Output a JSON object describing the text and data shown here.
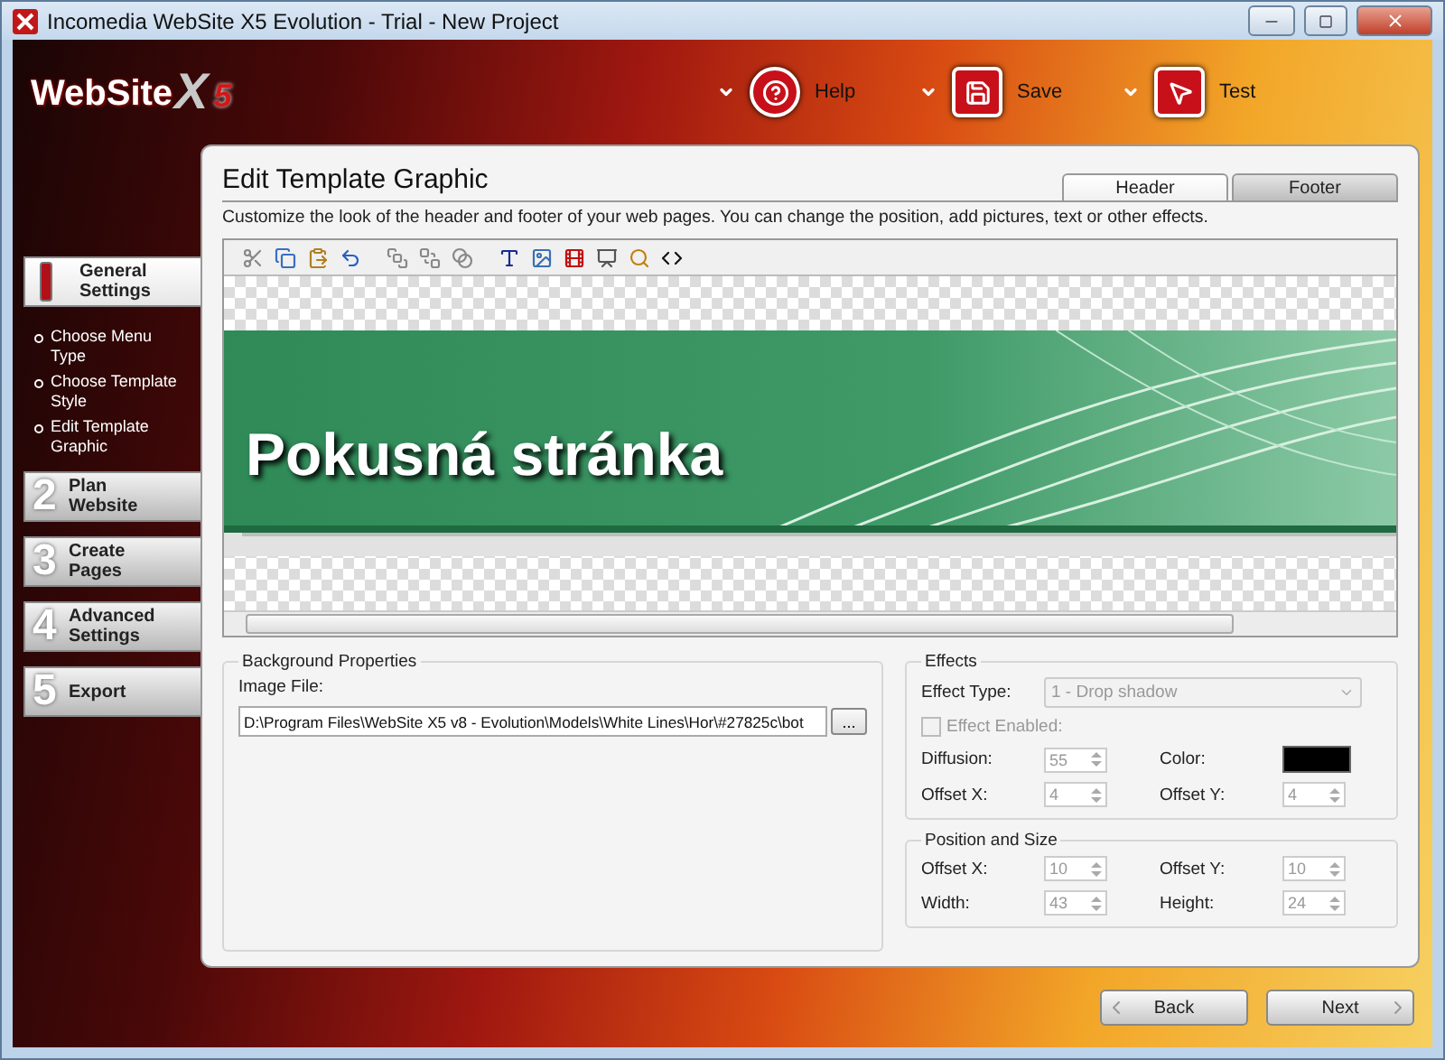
{
  "window": {
    "title": "Incomedia WebSite X5 Evolution - Trial - New Project"
  },
  "logo": {
    "name": "WebSite",
    "mark": "X",
    "version": "5"
  },
  "toolbar": [
    {
      "kind": "help",
      "label": "Help"
    },
    {
      "kind": "save",
      "label": "Save"
    },
    {
      "kind": "test",
      "label": "Test"
    }
  ],
  "steps": [
    {
      "label": "General Settings",
      "selected": true,
      "children": [
        {
          "label": "Choose Menu Type"
        },
        {
          "label": "Choose Template Style"
        },
        {
          "label": "Edit Template Graphic"
        }
      ]
    },
    {
      "number": "2",
      "label": "Plan Website",
      "selected": false
    },
    {
      "number": "3",
      "label": "Create Pages",
      "selected": false
    },
    {
      "number": "4",
      "label": "Advanced Settings",
      "selected": false
    },
    {
      "number": "5",
      "label": "Export",
      "selected": false
    }
  ],
  "page": {
    "title": "Edit Template Graphic",
    "description": "Customize the look of the header and footer of your web pages. You can change the position, add pictures, text or other effects.",
    "tabs": [
      {
        "label": "Header",
        "selected": true
      },
      {
        "label": "Footer",
        "selected": false
      }
    ]
  },
  "preview": {
    "heading": "Pokusná stránka"
  },
  "background": {
    "legend": "Background Properties",
    "image_file": {
      "label": "Image File:",
      "value": "D:\\Program Files\\WebSite X5 v8 - Evolution\\Models\\White Lines\\Hor\\#27825c\\bot",
      "browse": "..."
    }
  },
  "effects": {
    "legend": "Effects",
    "effect_type": {
      "label": "Effect Type:",
      "value": "1 - Drop shadow",
      "disabled": true
    },
    "effect_enabled": {
      "label": "Effect Enabled:",
      "checked": false,
      "disabled": true
    },
    "fields": [
      {
        "kind": "spin",
        "label": "Diffusion:",
        "value": "55",
        "disabled": true
      },
      {
        "kind": "color",
        "label": "Color:",
        "color": "#000000"
      },
      {
        "kind": "spin",
        "label": "Offset X:",
        "value": "4",
        "disabled": true
      },
      {
        "kind": "spin",
        "label": "Offset Y:",
        "value": "4",
        "disabled": true
      }
    ]
  },
  "position": {
    "legend": "Position and Size",
    "fields": [
      {
        "kind": "spin",
        "label": "Offset X:",
        "value": "10",
        "disabled": true
      },
      {
        "kind": "spin",
        "label": "Offset Y:",
        "value": "10",
        "disabled": true
      },
      {
        "kind": "spin",
        "label": "Width:",
        "value": "43",
        "disabled": true
      },
      {
        "kind": "spin",
        "label": "Height:",
        "value": "24",
        "disabled": true
      }
    ]
  },
  "navigation": [
    {
      "kind": "back",
      "label": "Back"
    },
    {
      "kind": "next",
      "label": "Next"
    }
  ]
}
